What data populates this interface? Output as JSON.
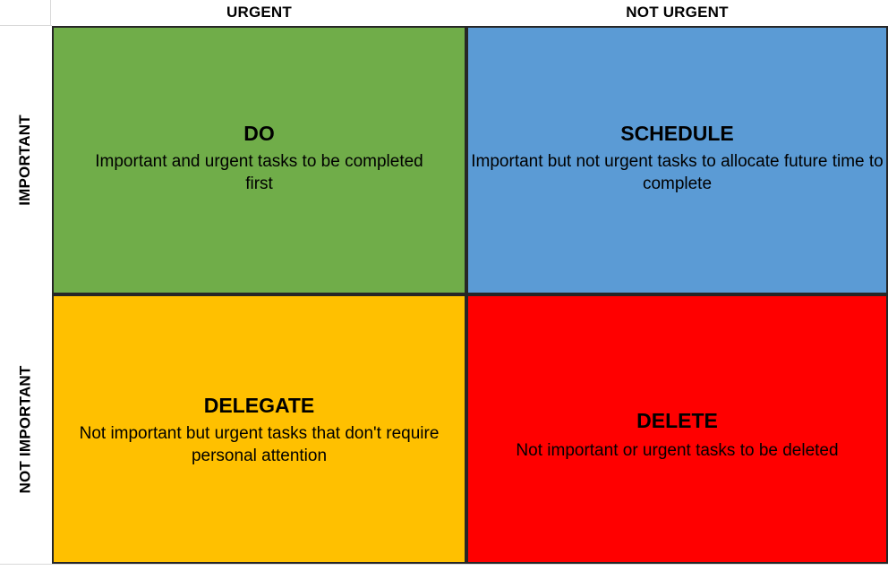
{
  "diagram": {
    "type": "eisenhower-matrix",
    "axes": {
      "columns": [
        {
          "key": "urgent",
          "label": "URGENT"
        },
        {
          "key": "not_urgent",
          "label": "NOT URGENT"
        }
      ],
      "rows": [
        {
          "key": "important",
          "label": "IMPORTANT"
        },
        {
          "key": "not_important",
          "label": "NOT IMPORTANT"
        }
      ]
    },
    "quadrants": [
      {
        "key": "do",
        "title": "DO",
        "description": "Important and urgent tasks to be completed first",
        "color": "#70AD49",
        "row": "IMPORTANT",
        "column": "URGENT"
      },
      {
        "key": "schedule",
        "title": "SCHEDULE",
        "description": "Important but not urgent tasks to allocate future time to complete",
        "color": "#5B9BD5",
        "row": "IMPORTANT",
        "column": "NOT URGENT"
      },
      {
        "key": "delegate",
        "title": "DELEGATE",
        "description": "Not important but urgent tasks that don't require personal attention",
        "color": "#FFC000",
        "row": "NOT IMPORTANT",
        "column": "URGENT"
      },
      {
        "key": "delete",
        "title": "DELETE",
        "description": "Not important or urgent tasks to be deleted",
        "color": "#FF0000",
        "row": "NOT IMPORTANT",
        "column": "NOT URGENT"
      }
    ],
    "colors": {
      "border": "#262626",
      "gridline": "#d9d9d9",
      "text": "#000000",
      "background": "#ffffff"
    }
  }
}
